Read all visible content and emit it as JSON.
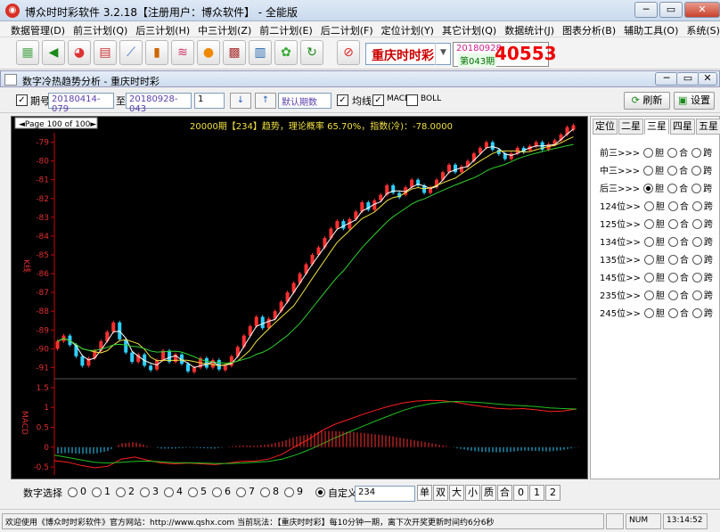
{
  "window": {
    "title": "博众时时彩软件 3.2.18【注册用户：博众软件】 - 全能版",
    "logo": "logo-icon",
    "minimize": "─",
    "restore": "▭",
    "close": "✕"
  },
  "menu": [
    "数据管理(D)",
    "前三计划(Q)",
    "后三计划(H)",
    "中三计划(Z)",
    "前二计划(E)",
    "后二计划(F)",
    "定位计划(Y)",
    "其它计划(Q)",
    "数据统计(J)",
    "图表分析(B)",
    "辅助工具(O)",
    "系统(S)"
  ],
  "toolbar": {
    "icons": [
      "grid-icon",
      "back-icon",
      "pie-icon",
      "table-icon",
      "line-chart-icon",
      "bar-chart-icon",
      "trend-icon",
      "alarm-icon",
      "matrix-icon",
      "calculator-icon",
      "gear-icon",
      "refresh-icon",
      "stop-icon"
    ],
    "lottery": "重庆时时彩",
    "issue_date": "20180928",
    "issue_no": "第043期",
    "draw_number": "40553"
  },
  "subwindow": {
    "title": "数字冷热趋势分析 - 重庆时时彩"
  },
  "params": {
    "period_label": "期号",
    "start": "20180414-079",
    "to_label": "至",
    "end": "20180928-043",
    "step": "1",
    "down": "↓",
    "up": "↑",
    "mode": "默认期数",
    "ma_label": "均线",
    "macd_label": "MACD",
    "boll_label": "BOLL",
    "refresh": "刷新",
    "settings": "设置"
  },
  "chart_data": {
    "type": "candlestick",
    "page_label": "◄Page 100 of 100►",
    "header": "20000期【234】趋势，理论概率 65.70%，指数(冷)：-78.0000",
    "ylabel_main": "K线",
    "ylabel_macd": "MACD",
    "yticks_main": [
      "-79",
      "-80",
      "-81",
      "-82",
      "-83",
      "-84",
      "-85",
      "-86",
      "-87",
      "-88",
      "-89",
      "-90",
      "-91"
    ],
    "yticks_macd": [
      "1.5",
      "1",
      "0.5",
      "0",
      "-0.5"
    ],
    "ylim_main": [
      -91.5,
      -78.5
    ],
    "ylim_macd": [
      -0.7,
      1.7
    ],
    "closes": [
      -89.6,
      -89.3,
      -89.8,
      -90.4,
      -90.9,
      -90.5,
      -90.1,
      -89.6,
      -89.1,
      -88.6,
      -89.5,
      -90.2,
      -90.7,
      -90.3,
      -90.9,
      -91.1,
      -90.6,
      -90.1,
      -90.7,
      -90.3,
      -90.8,
      -91.2,
      -91.0,
      -90.5,
      -91.0,
      -90.6,
      -91.1,
      -90.9,
      -90.4,
      -89.9,
      -89.3,
      -88.8,
      -88.3,
      -88.9,
      -88.4,
      -88.0,
      -87.5,
      -87.0,
      -86.5,
      -86.0,
      -85.5,
      -85.0,
      -84.6,
      -84.1,
      -83.6,
      -83.2,
      -83.6,
      -83.1,
      -82.7,
      -82.2,
      -82.6,
      -82.1,
      -81.8,
      -81.3,
      -81.7,
      -81.8,
      -81.4,
      -81.0,
      -81.3,
      -81.7,
      -81.4,
      -81.0,
      -80.6,
      -80.2,
      -80.6,
      -80.3,
      -80.0,
      -79.6,
      -79.3,
      -79.0,
      -79.4,
      -79.6,
      -79.9,
      -79.6,
      -79.3,
      -79.4,
      -79.2,
      -79.0,
      -79.4,
      -79.1,
      -78.9,
      -78.6,
      -78.2,
      -78.1
    ],
    "macd_dif": [
      -0.34,
      -0.38,
      -0.46,
      -0.52,
      -0.48,
      -0.3,
      -0.25,
      -0.33,
      -0.4,
      -0.42,
      -0.4,
      -0.42,
      -0.44,
      -0.4,
      -0.36,
      -0.35,
      -0.3,
      -0.18,
      0.02,
      0.2,
      0.42,
      0.58,
      0.7,
      0.82,
      0.93,
      1.03,
      1.11,
      1.16,
      1.18,
      1.17,
      1.13,
      1.07,
      1.02,
      0.98,
      0.96,
      0.97,
      0.94,
      0.9,
      0.91,
      0.96
    ],
    "macd_dea": [
      -0.2,
      -0.26,
      -0.32,
      -0.38,
      -0.4,
      -0.38,
      -0.36,
      -0.35,
      -0.37,
      -0.39,
      -0.39,
      -0.4,
      -0.41,
      -0.41,
      -0.4,
      -0.38,
      -0.36,
      -0.3,
      -0.2,
      -0.07,
      0.08,
      0.24,
      0.38,
      0.52,
      0.66,
      0.79,
      0.92,
      1.02,
      1.09,
      1.13,
      1.15,
      1.14,
      1.12,
      1.09,
      1.06,
      1.04,
      1.02,
      0.99,
      0.97,
      0.96
    ]
  },
  "panel": {
    "tabs": [
      "定位",
      "二星",
      "三星",
      "四星",
      "五星"
    ],
    "rows": [
      "前三>>>",
      "中三>>>",
      "后三>>>",
      "124位>>",
      "125位>>",
      "134位>>",
      "135位>>",
      "145位>>",
      "235位>>",
      "245位>>"
    ],
    "options": [
      "胆",
      "合",
      "跨"
    ],
    "selected_row": 2
  },
  "bottom": {
    "label": "数字选择",
    "digits": [
      "0",
      "1",
      "2",
      "3",
      "4",
      "5",
      "6",
      "7",
      "8",
      "9"
    ],
    "custom_label": "自定义",
    "custom_value": "234",
    "quick": [
      "单",
      "双",
      "大",
      "小",
      "质",
      "合",
      "0",
      "1",
      "2"
    ]
  },
  "status": {
    "message": "欢迎使用《博众时时彩软件》官方网站：http://www.qshx.com 当前玩法：【重庆时时彩】每10分钟一期，离下次开奖更新时间约6分6秒",
    "num": "NUM",
    "time": "13:14:52"
  }
}
